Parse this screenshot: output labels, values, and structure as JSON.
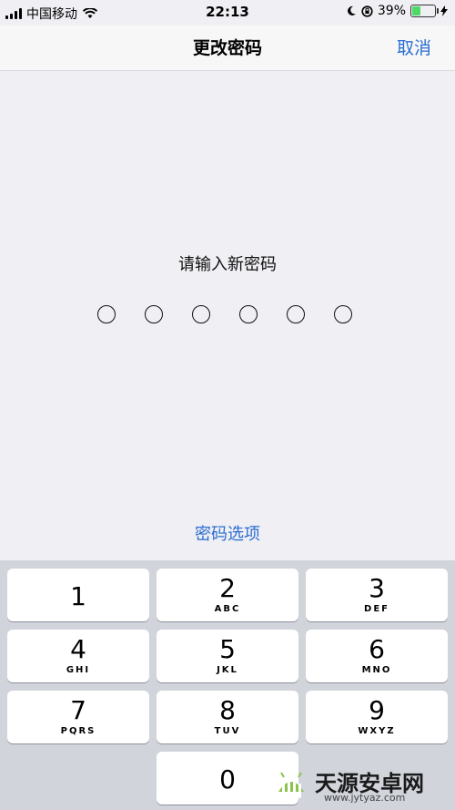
{
  "status": {
    "carrier": "中国移动",
    "time": "22:13",
    "battery_text": "39%",
    "battery_level": 0.39
  },
  "nav": {
    "title": "更改密码",
    "cancel": "取消"
  },
  "prompt": "请输入新密码",
  "passcode_length": 6,
  "options": "密码选项",
  "keys": [
    {
      "num": "1",
      "letters": ""
    },
    {
      "num": "2",
      "letters": "ABC"
    },
    {
      "num": "3",
      "letters": "DEF"
    },
    {
      "num": "4",
      "letters": "GHI"
    },
    {
      "num": "5",
      "letters": "JKL"
    },
    {
      "num": "6",
      "letters": "MNO"
    },
    {
      "num": "7",
      "letters": "PQRS"
    },
    {
      "num": "8",
      "letters": "TUV"
    },
    {
      "num": "9",
      "letters": "WXYZ"
    },
    {
      "num": "0",
      "letters": ""
    }
  ],
  "watermark": {
    "name": "天源安卓网",
    "url": "www.jytyaz.com"
  },
  "colors": {
    "accent": "#2b6dd1",
    "background": "#efeff4",
    "keypad": "#d1d4db",
    "battery": "#4cd964"
  }
}
